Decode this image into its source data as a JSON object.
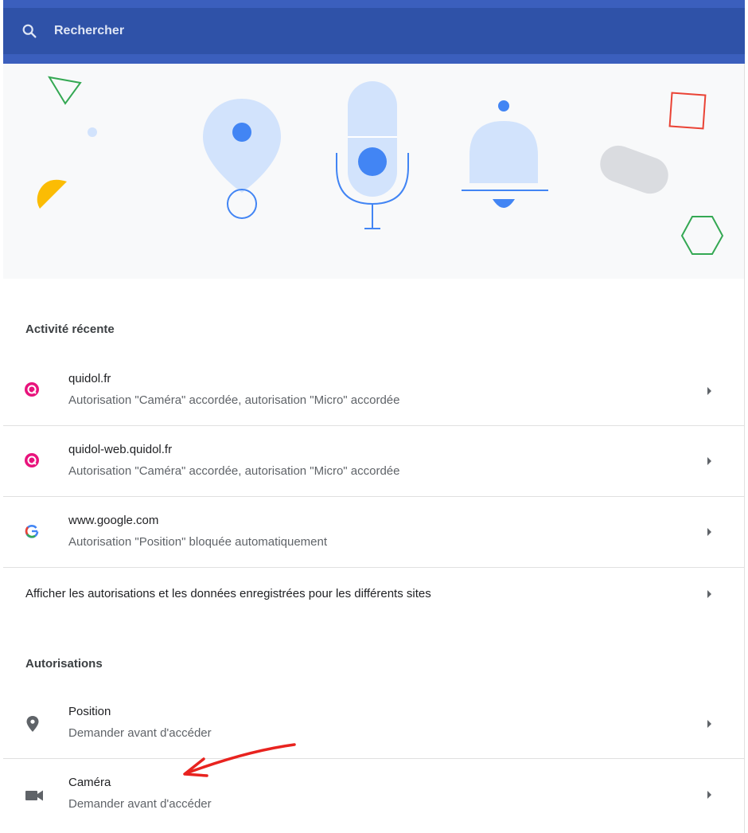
{
  "search": {
    "placeholder": "Rechercher",
    "icon": "search-icon"
  },
  "banner": {
    "illustrations": [
      "triangle-outline",
      "dot",
      "half-disc",
      "location-pin",
      "microphone",
      "bell",
      "pill-shape",
      "square-outline",
      "hexagon-outline"
    ],
    "colors": {
      "pale_blue": "#d2e3fc",
      "blue": "#4285f4",
      "yellow": "#fbbc04",
      "red": "#ea4335",
      "green": "#34a853",
      "gray": "#dadce0"
    }
  },
  "recent": {
    "header": "Activité récente",
    "items": [
      {
        "site": "quidol.fr",
        "detail": "Autorisation \"Caméra\" accordée, autorisation \"Micro\" accordée",
        "favicon": "quidol-favicon"
      },
      {
        "site": "quidol-web.quidol.fr",
        "detail": "Autorisation \"Caméra\" accordée, autorisation \"Micro\" accordée",
        "favicon": "quidol-favicon"
      },
      {
        "site": "www.google.com",
        "detail": "Autorisation \"Position\" bloquée automatiquement",
        "favicon": "google-favicon"
      }
    ],
    "all_sites": "Afficher les autorisations et les données enregistrées pour les différents sites"
  },
  "permissions": {
    "header": "Autorisations",
    "items": [
      {
        "name": "Position",
        "detail": "Demander avant d'accéder",
        "icon": "location-icon"
      },
      {
        "name": "Caméra",
        "detail": "Demander avant d'accéder",
        "icon": "videocam-icon"
      }
    ]
  },
  "annotation": {
    "type": "red-arrow",
    "color": "#e8231f"
  },
  "colors": {
    "header_bg": "#2f52a8",
    "divider": "#e0e0e0",
    "quidol_pink": "#e8137c"
  }
}
